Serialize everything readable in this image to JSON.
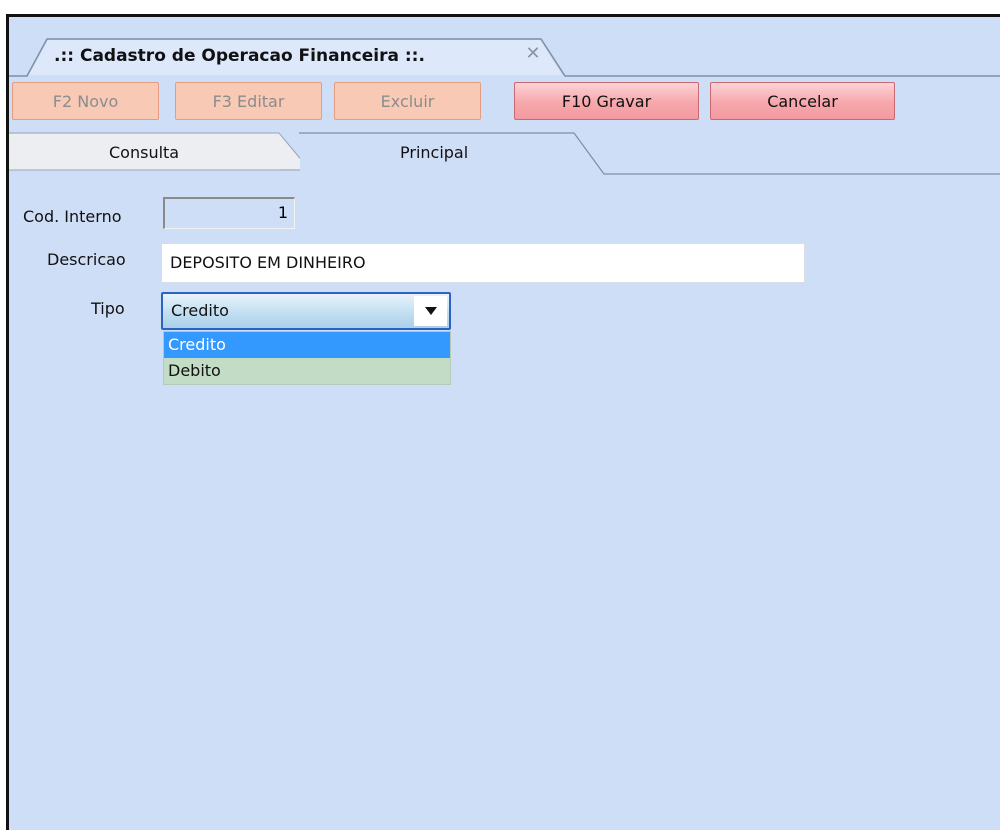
{
  "window": {
    "doc_tab_title": ".:: Cadastro de Operacao Financeira ::.",
    "close_glyph": "✕"
  },
  "toolbar": {
    "buttons": [
      {
        "label": "F2 Novo",
        "enabled": false
      },
      {
        "label": "F3 Editar",
        "enabled": false
      },
      {
        "label": "Excluir",
        "enabled": false
      },
      {
        "label": "F10 Gravar",
        "enabled": true
      },
      {
        "label": "Cancelar",
        "enabled": true
      }
    ]
  },
  "tabs": [
    {
      "label": "Consulta",
      "active": false
    },
    {
      "label": "Principal",
      "active": true
    }
  ],
  "form": {
    "cod_interno": {
      "label": "Cod. Interno",
      "value": "1"
    },
    "descricao": {
      "label": "Descricao",
      "value": "DEPOSITO EM DINHEIRO"
    },
    "tipo": {
      "label": "Tipo",
      "value": "Credito",
      "options": [
        "Credito",
        "Debito"
      ],
      "highlighted": "Credito"
    }
  },
  "colors": {
    "background": "#cfdef7",
    "disabled_button": "#f8c9b4",
    "enabled_button": "#f6a7ac",
    "highlight": "#3399ff",
    "list_bg": "#c3dcc5"
  }
}
